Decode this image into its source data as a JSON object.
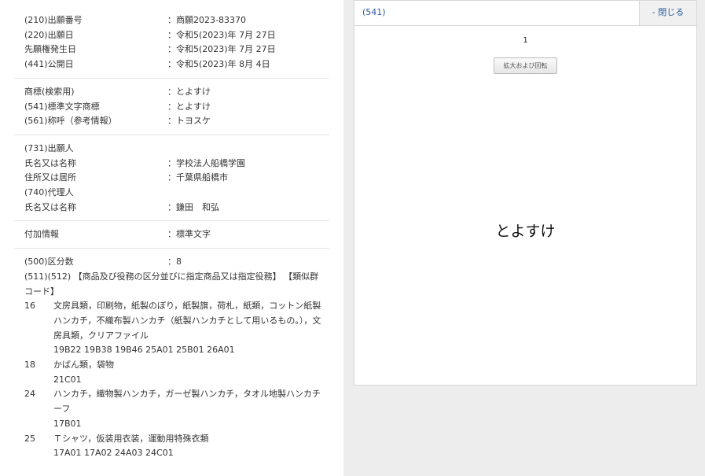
{
  "basic": [
    {
      "label": "(210)出願番号",
      "value": "：商願2023-83370"
    },
    {
      "label": "(220)出願日",
      "value": "：令和5(2023)年 7月 27日"
    },
    {
      "label": "先願権発生日",
      "value": "：令和5(2023)年 7月 27日"
    },
    {
      "label": "(441)公開日",
      "value": "：令和5(2023)年 8月 4日"
    }
  ],
  "mark_info": [
    {
      "label": "商標(検索用)",
      "value": "：とよすけ"
    },
    {
      "label": "(541)標準文字商標",
      "value": "：とよすけ"
    },
    {
      "label": "(561)称呼（参考情報）",
      "value": "：トヨスケ"
    }
  ],
  "applicant": [
    {
      "label": "(731)出願人",
      "value": ""
    },
    {
      "label": "氏名又は名称",
      "value": "：学校法人船橋学園"
    },
    {
      "label": "住所又は居所",
      "value": "：千葉県船橋市"
    },
    {
      "label": "(740)代理人",
      "value": ""
    },
    {
      "label": "氏名又は名称",
      "value": "：鎌田　和弘"
    }
  ],
  "additional": [
    {
      "label": "付加情報",
      "value": "：標準文字"
    }
  ],
  "classes": {
    "label": "(500)区分数",
    "value": "：8",
    "goods_heading": "(511)(512) 【商品及び役務の区分並びに指定商品又は指定役務】 【類似群コード】",
    "items": [
      {
        "num": "16",
        "text": "文房具類，印刷物，紙製のぼり，紙製旗，荷札，紙類，コットン紙製ハンカチ，不織布製ハンカチ（紙製ハンカチとして用いるもの。），文房具類，クリアファイル",
        "codes": "19B22 19B38 19B46 25A01 25B01 26A01"
      },
      {
        "num": "18",
        "text": "かばん類，袋物",
        "codes": "21C01"
      },
      {
        "num": "24",
        "text": "ハンカチ，織物製ハンカチ，ガーゼ製ハンカチ，タオル地製ハンカチーフ",
        "codes": "17B01"
      },
      {
        "num": "25",
        "text": "Ｔシャツ，仮装用衣装，運動用特殊衣類",
        "codes": "17A01 17A02 24A03 24C01"
      }
    ]
  },
  "viewer": {
    "code": "(541)",
    "close_label": "- 閉じる",
    "page": "1",
    "zoom_label": "拡大および回転",
    "mark_text": "とよすけ"
  }
}
